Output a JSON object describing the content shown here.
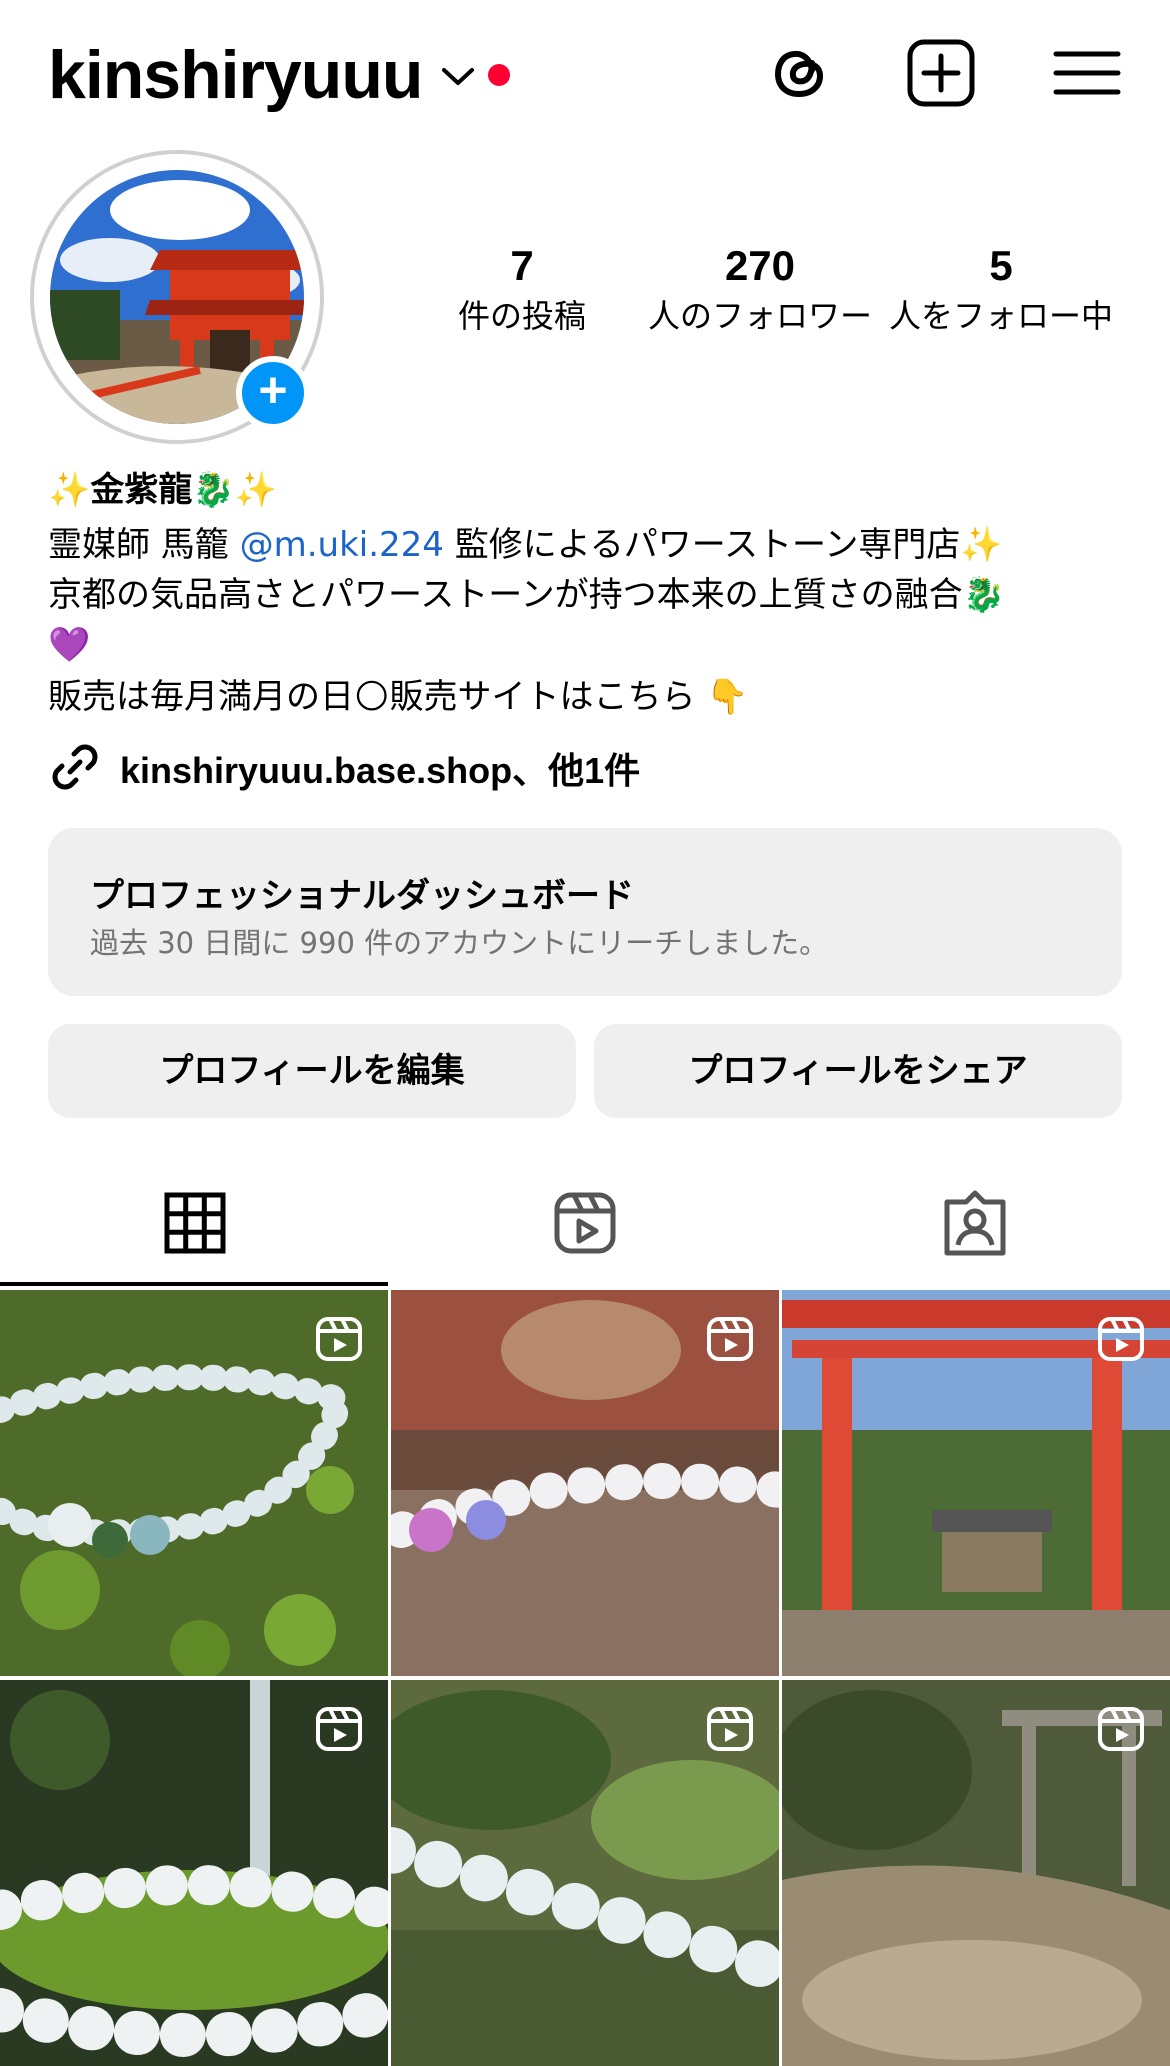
{
  "header": {
    "username": "kinshiryuuu",
    "icons": [
      "chevron-down-icon",
      "threads-icon",
      "create-post-icon",
      "menu-icon"
    ],
    "notification_dot_color": "#ff0033"
  },
  "profile": {
    "stats": [
      {
        "num": "7",
        "label": "件の投稿"
      },
      {
        "num": "270",
        "label": "人のフォロワー"
      },
      {
        "num": "5",
        "label": "人をフォロー中"
      }
    ],
    "add_story_color": "#0095f6",
    "name": "✨金紫龍🐉✨",
    "bio_line1_a": "霊媒師 馬籠 ",
    "bio_mention": "@m.uki.224",
    "bio_line1_b": "  監修によるパワーストーン専門店✨",
    "bio_line2": "京都の気品高さとパワーストーンが持つ本来の上質さの融合🐉",
    "bio_line3": "💜",
    "bio_line4": "販売は毎月満月の日🌕販売サイトはこちら 👇",
    "link": "kinshiryuuu.base.shop、他1件"
  },
  "dashboard": {
    "title": "プロフェッショナルダッシュボード",
    "subtitle": "過去 30 日間に 990 件のアカウントにリーチしました。"
  },
  "buttons": {
    "edit": "プロフィールを編集",
    "share": "プロフィールをシェア"
  },
  "tabs": [
    "grid-icon",
    "reels-icon",
    "tagged-icon"
  ],
  "grid": [
    {
      "name": "post-bracelet-moss",
      "type": "reel"
    },
    {
      "name": "post-bracelet-water",
      "type": "reel"
    },
    {
      "name": "post-torii-shrine",
      "type": "reel"
    },
    {
      "name": "post-bracelet-waterfall",
      "type": "reel"
    },
    {
      "name": "post-bracelet-forest",
      "type": "reel"
    },
    {
      "name": "post-stream-torii",
      "type": "reel"
    }
  ]
}
